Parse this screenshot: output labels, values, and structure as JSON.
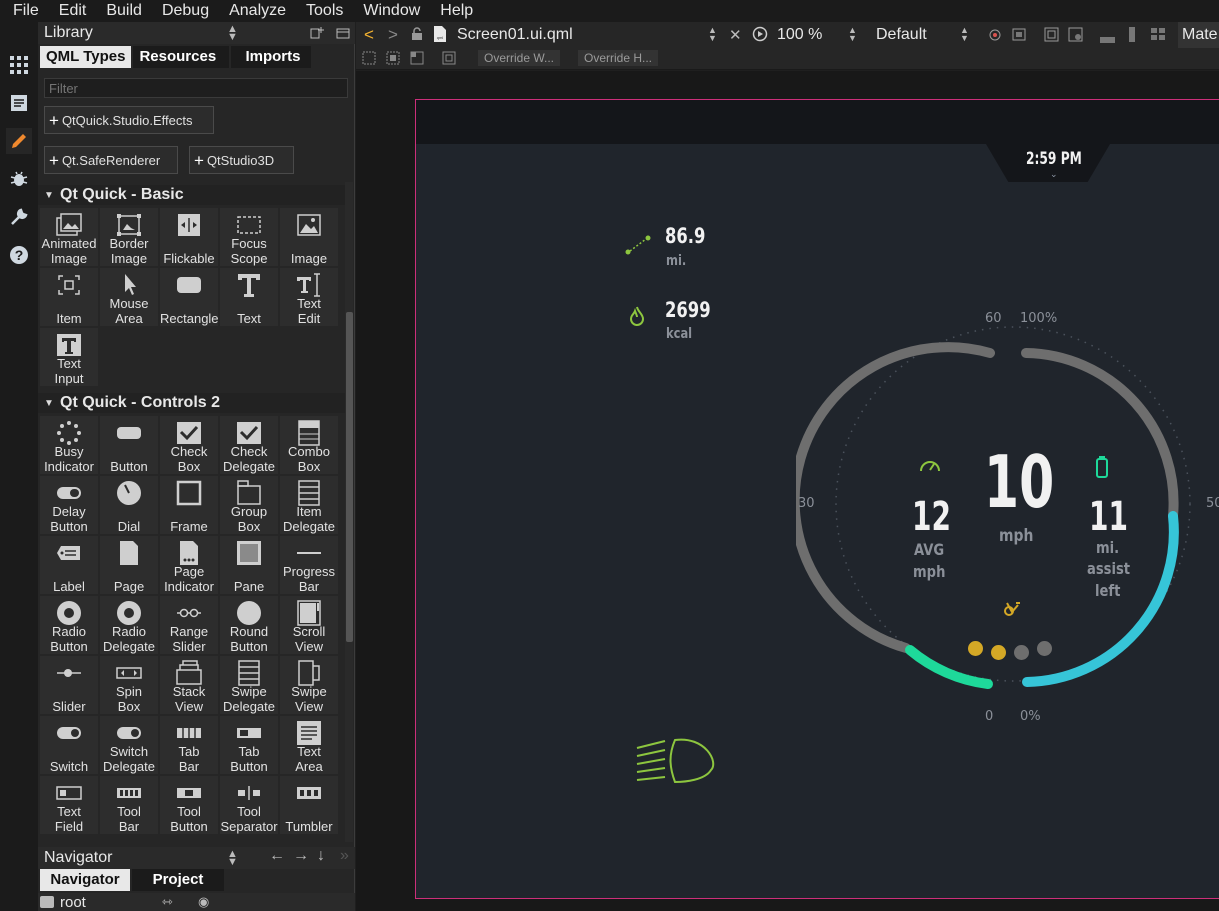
{
  "menu": [
    "File",
    "Edit",
    "Build",
    "Debug",
    "Analyze",
    "Tools",
    "Window",
    "Help"
  ],
  "library": {
    "title": "Library",
    "tabs": [
      "QML Types",
      "Resources",
      "Imports"
    ],
    "filter_placeholder": "Filter",
    "imports": [
      "QtQuick.Studio.Effects",
      "Qt.SafeRenderer",
      "QtStudio3D"
    ],
    "sections": [
      {
        "title": "Qt Quick - Basic",
        "items": [
          {
            "label": "Animated Image",
            "icon": "animated-image-icon"
          },
          {
            "label": "Border Image",
            "icon": "border-image-icon"
          },
          {
            "label": "Flickable",
            "icon": "flickable-icon"
          },
          {
            "label": "Focus Scope",
            "icon": "focus-scope-icon"
          },
          {
            "label": "Image",
            "icon": "image-icon"
          },
          {
            "label": "Item",
            "icon": "item-icon"
          },
          {
            "label": "Mouse Area",
            "icon": "mouse-area-icon"
          },
          {
            "label": "Rectangle",
            "icon": "rectangle-icon"
          },
          {
            "label": "Text",
            "icon": "text-icon"
          },
          {
            "label": "Text Edit",
            "icon": "text-edit-icon"
          },
          {
            "label": "Text Input",
            "icon": "text-input-icon"
          }
        ]
      },
      {
        "title": "Qt Quick - Controls 2",
        "items": [
          {
            "label": "Busy Indicator",
            "icon": "busy-indicator-icon"
          },
          {
            "label": "Button",
            "icon": "button-icon"
          },
          {
            "label": "Check Box",
            "icon": "check-box-icon"
          },
          {
            "label": "Check Delegate",
            "icon": "check-delegate-icon"
          },
          {
            "label": "Combo Box",
            "icon": "combo-box-icon"
          },
          {
            "label": "Delay Button",
            "icon": "delay-button-icon"
          },
          {
            "label": "Dial",
            "icon": "dial-icon"
          },
          {
            "label": "Frame",
            "icon": "frame-icon"
          },
          {
            "label": "Group Box",
            "icon": "group-box-icon"
          },
          {
            "label": "Item Delegate",
            "icon": "item-delegate-icon"
          },
          {
            "label": "Label",
            "icon": "label-icon"
          },
          {
            "label": "Page",
            "icon": "page-icon"
          },
          {
            "label": "Page Indicator",
            "icon": "page-indicator-icon"
          },
          {
            "label": "Pane",
            "icon": "pane-icon"
          },
          {
            "label": "Progress Bar",
            "icon": "progress-bar-icon"
          },
          {
            "label": "Radio Button",
            "icon": "radio-button-icon"
          },
          {
            "label": "Radio Delegate",
            "icon": "radio-delegate-icon"
          },
          {
            "label": "Range Slider",
            "icon": "range-slider-icon"
          },
          {
            "label": "Round Button",
            "icon": "round-button-icon"
          },
          {
            "label": "Scroll View",
            "icon": "scroll-view-icon"
          },
          {
            "label": "Slider",
            "icon": "slider-icon"
          },
          {
            "label": "Spin Box",
            "icon": "spin-box-icon"
          },
          {
            "label": "Stack View",
            "icon": "stack-view-icon"
          },
          {
            "label": "Swipe Delegate",
            "icon": "swipe-delegate-icon"
          },
          {
            "label": "Swipe View",
            "icon": "swipe-view-icon"
          },
          {
            "label": "Switch",
            "icon": "switch-icon"
          },
          {
            "label": "Switch Delegate",
            "icon": "switch-delegate-icon"
          },
          {
            "label": "Tab Bar",
            "icon": "tab-bar-icon"
          },
          {
            "label": "Tab Button",
            "icon": "tab-button-icon"
          },
          {
            "label": "Text Area",
            "icon": "text-area-icon"
          },
          {
            "label": "Text Field",
            "icon": "text-field-icon"
          },
          {
            "label": "Tool Bar",
            "icon": "tool-bar-icon"
          },
          {
            "label": "Tool Button",
            "icon": "tool-button-icon"
          },
          {
            "label": "Tool Separator",
            "icon": "tool-separator-icon"
          },
          {
            "label": "Tumbler",
            "icon": "tumbler-icon"
          }
        ]
      }
    ]
  },
  "navigator": {
    "title": "Navigator",
    "tabs": [
      "Navigator",
      "Project"
    ],
    "root": "root"
  },
  "editor": {
    "file": "Screen01.ui.qml",
    "zoom": "100 %",
    "state": "Default",
    "style": "Mate",
    "override_width": "Override W...",
    "override_height": "Override H..."
  },
  "dashboard": {
    "time": "2:59 PM",
    "distance_value": "86.9",
    "distance_unit": "mi.",
    "calories_value": "2699",
    "calories_unit": "kcal",
    "speed": "10",
    "speed_unit": "mph",
    "avg_value": "12",
    "avg_label": "AVG",
    "avg_unit": "mph",
    "assist_value": "11",
    "assist_unit": "mi.",
    "assist_label1": "assist",
    "assist_label2": "left",
    "tick_60": "60",
    "tick_100pct": "100%",
    "tick_30": "30",
    "tick_50": "50",
    "tick_0": "0",
    "tick_0pct": "0%",
    "colors": {
      "green": "#8dc63f",
      "teal": "#36c5d8",
      "mint": "#1ed99a",
      "gauge": "#6e6e6e",
      "yellow": "#d4a826"
    }
  }
}
